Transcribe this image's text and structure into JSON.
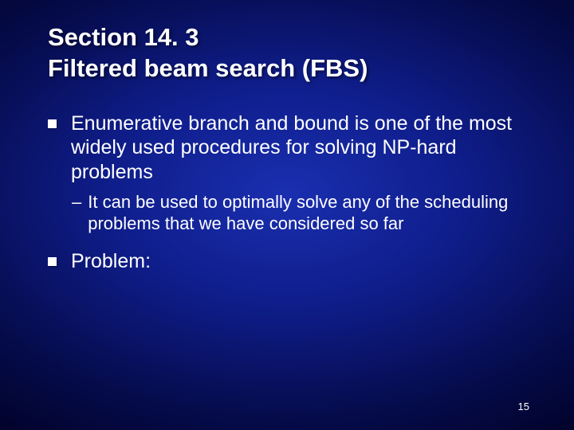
{
  "title_line1": "Section 14. 3",
  "title_line2": "Filtered beam search (FBS)",
  "bullets": {
    "b1": "Enumerative branch and bound is one of the most widely used procedures for solving NP-hard problems",
    "b1_sub1": "It can be used to optimally solve any of the scheduling problems that we have considered so far",
    "b2": "Problem:"
  },
  "page_number": "15"
}
